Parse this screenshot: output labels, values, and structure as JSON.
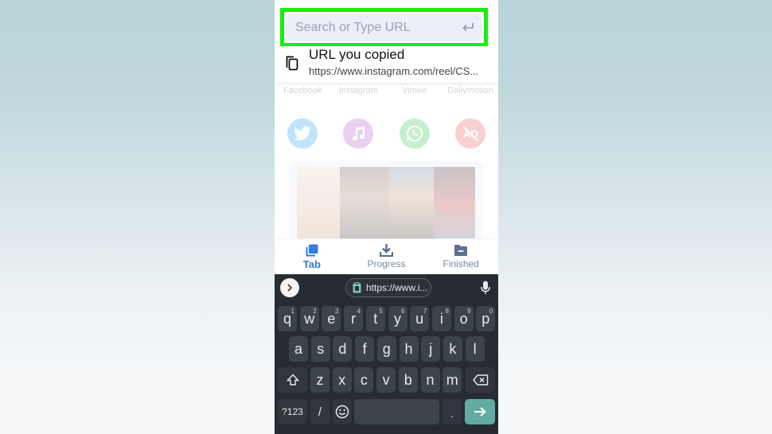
{
  "search": {
    "placeholder": "Search or Type URL",
    "value": "",
    "enter_icon": "return-arrow-icon"
  },
  "clipboard_suggestion": {
    "title": "URL you copied",
    "url": "https://www.instagram.com/reel/CS..."
  },
  "platforms": {
    "labels": [
      "Facebook",
      "Instagram",
      "Vimeo",
      "Dailymotion"
    ],
    "icons": [
      {
        "name": "twitter-icon",
        "color": "#1da1f2"
      },
      {
        "name": "music-icon",
        "color": "#b659d6"
      },
      {
        "name": "whatsapp-icon",
        "color": "#35c35b"
      },
      {
        "name": "ad-block-icon",
        "color": "#e9585b"
      }
    ]
  },
  "tabs": [
    {
      "label": "Tab",
      "icon": "tabs-icon",
      "active": true
    },
    {
      "label": "Progress",
      "icon": "download-icon",
      "active": false
    },
    {
      "label": "Finished",
      "icon": "folder-icon",
      "active": false
    }
  ],
  "keyboard": {
    "clipboard_chip": "https://www.i...",
    "row1": [
      {
        "k": "q",
        "n": "1"
      },
      {
        "k": "w",
        "n": "2"
      },
      {
        "k": "e",
        "n": "3"
      },
      {
        "k": "r",
        "n": "4"
      },
      {
        "k": "t",
        "n": "5"
      },
      {
        "k": "y",
        "n": "6"
      },
      {
        "k": "u",
        "n": "7"
      },
      {
        "k": "i",
        "n": "8"
      },
      {
        "k": "o",
        "n": "9"
      },
      {
        "k": "p",
        "n": "0"
      }
    ],
    "row2": [
      "a",
      "s",
      "d",
      "f",
      "g",
      "h",
      "j",
      "k",
      "l"
    ],
    "row3": [
      "z",
      "x",
      "c",
      "v",
      "b",
      "n",
      "m"
    ],
    "symbols_label": "?123",
    "slash_label": "/",
    "period_label": ".",
    "enter_color": "#63aba2"
  },
  "colors": {
    "highlight": "#12f00e",
    "accent": "#2e7ae6",
    "keyboard_bg": "#262c32"
  }
}
